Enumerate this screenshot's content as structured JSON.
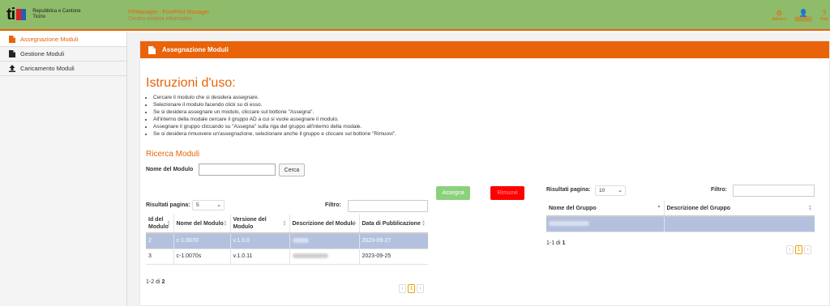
{
  "header": {
    "logo_text": "ti",
    "org_line1": "Repubblica e Cantone",
    "org_line2": "Ticino",
    "app_title": "FPManager - FinePrint Manager",
    "app_subtitle": "Centro sistemi informativi",
    "actions": [
      {
        "icon": "gear-icon",
        "label": "Admin ▾"
      },
      {
        "icon": "user-icon",
        "label": "██████"
      },
      {
        "icon": "help-icon",
        "label": "Help"
      }
    ]
  },
  "sidebar": {
    "items": [
      {
        "label": "Assegnazione Moduli",
        "icon": "file-icon",
        "active": true
      },
      {
        "label": "Gestione Moduli",
        "icon": "file-icon",
        "active": false
      },
      {
        "label": "Caricamento Moduli",
        "icon": "upload-icon",
        "active": false
      }
    ]
  },
  "panel": {
    "title": "Assegnazione Moduli",
    "instructions_title": "Istruzioni d'uso:",
    "instructions": [
      "Cercare il modulo che si desidera assegnare.",
      "Selezionare il modulo facendo click su di esso.",
      "Se si desidera assegnare un modulo, cliccare sul bottone \"Assegna\".",
      "All'interno della modale cercare il gruppo AD a cui si vuole assegnare il modulo.",
      "Assegnare il gruppo cliccando su \"Assegna\" sulla riga del gruppo all'interno della modale.",
      "Se si desidera rimuovere un'assegnazione, selezionare anche il gruppo e cliccare sul bottone \"Rimuovi\"."
    ],
    "search_title": "Ricerca Moduli",
    "search_label": "Nome del Modulo",
    "search_value": "",
    "search_button": "Cerca",
    "assign_button": "Assegna",
    "remove_button": "Rimuovi"
  },
  "modules_table": {
    "page_size_label": "Risultati pagina:",
    "page_size": "5",
    "filter_label": "Filtro:",
    "columns": [
      "Id del Modulo",
      "Nome del Modulo",
      "Versione del Modulo",
      "Descrizione del Modulo",
      "Data di Pubblicazione"
    ],
    "rows": [
      {
        "id": "2",
        "name": "c-1.0070",
        "version": "v.1.0.0",
        "date": "2023-09-27",
        "selected": true
      },
      {
        "id": "3",
        "name": "c-1.0070s",
        "version": "v.1.0.11",
        "date": "2023-09-25",
        "selected": false
      }
    ],
    "count_prefix": "1-2 di ",
    "count_total": "2",
    "pager": {
      "prev": "‹",
      "current": "1",
      "next": "›"
    }
  },
  "groups_table": {
    "page_size_label": "Risultati pagina:",
    "page_size": "10",
    "filter_label": "Filtro:",
    "columns": [
      "Nome del Gruppo",
      "Descrizione del Gruppo"
    ],
    "count_prefix": "1-1 di ",
    "count_total": "1",
    "pager": {
      "prev": "‹",
      "current": "1",
      "next": "›"
    }
  },
  "colors": {
    "accent": "#e8630a",
    "header_bg": "#8fbc6b",
    "selected_row": "#b3c1de",
    "assign": "#8bd17c",
    "remove": "#ff0000"
  }
}
